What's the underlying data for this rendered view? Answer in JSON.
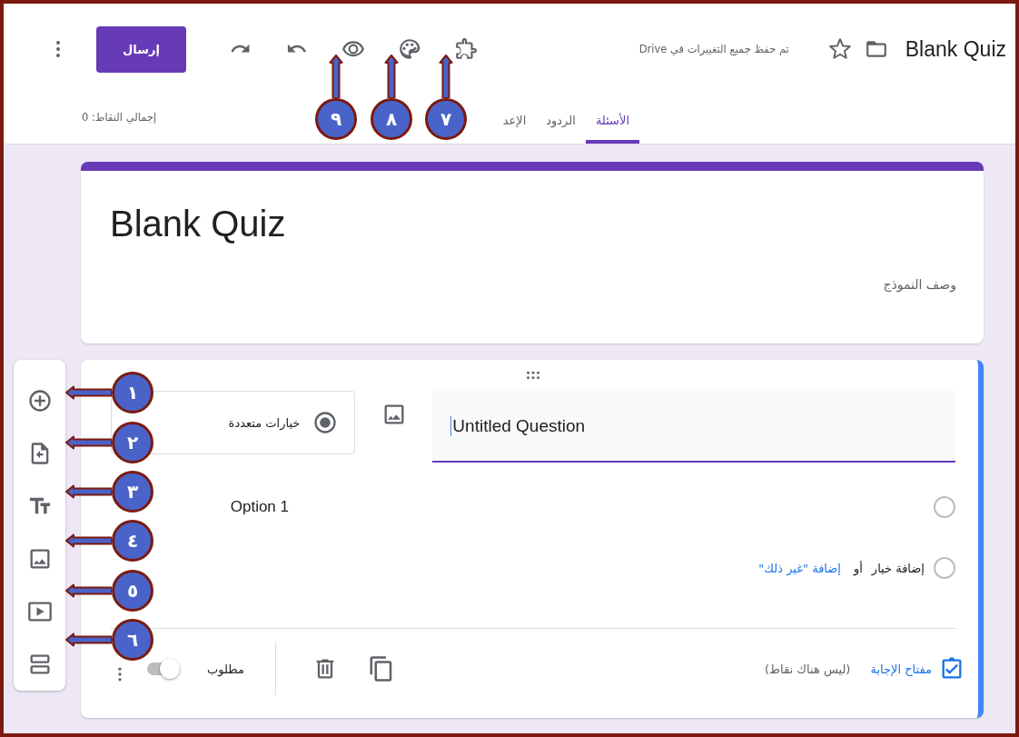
{
  "header": {
    "title": "Blank Quiz",
    "starred": false,
    "save_status": "تم حفظ جميع التغييرات في Drive",
    "send_button": "إرسال"
  },
  "tabs": [
    {
      "label": "الأسئلة",
      "selected": true
    },
    {
      "label": "الردود",
      "selected": false
    },
    {
      "label": "الإعد",
      "selected": false
    }
  ],
  "total_points": "إجمالي النقاط: 0",
  "form": {
    "title": "Blank Quiz",
    "description": "وصف النموذج"
  },
  "question": {
    "title": "Untitled Question",
    "type": "خيارات متعددة",
    "options": [
      {
        "label": "Option 1",
        "selected": false
      }
    ],
    "add_option_selected": false,
    "add_option": "إضافة خيار",
    "or": "أو",
    "add_other": "إضافة \"غير ذلك\"",
    "answer_key": "مفتاح الإجابة",
    "points": "(ليس هناك نقاط)",
    "required_label": "مطلوب",
    "required": false
  },
  "callouts": [
    {
      "number": "١"
    },
    {
      "number": "٢"
    },
    {
      "number": "٣"
    },
    {
      "number": "٤"
    },
    {
      "number": "٥"
    },
    {
      "number": "٦"
    },
    {
      "number": "٧"
    },
    {
      "number": "٨"
    },
    {
      "number": "٩"
    }
  ]
}
